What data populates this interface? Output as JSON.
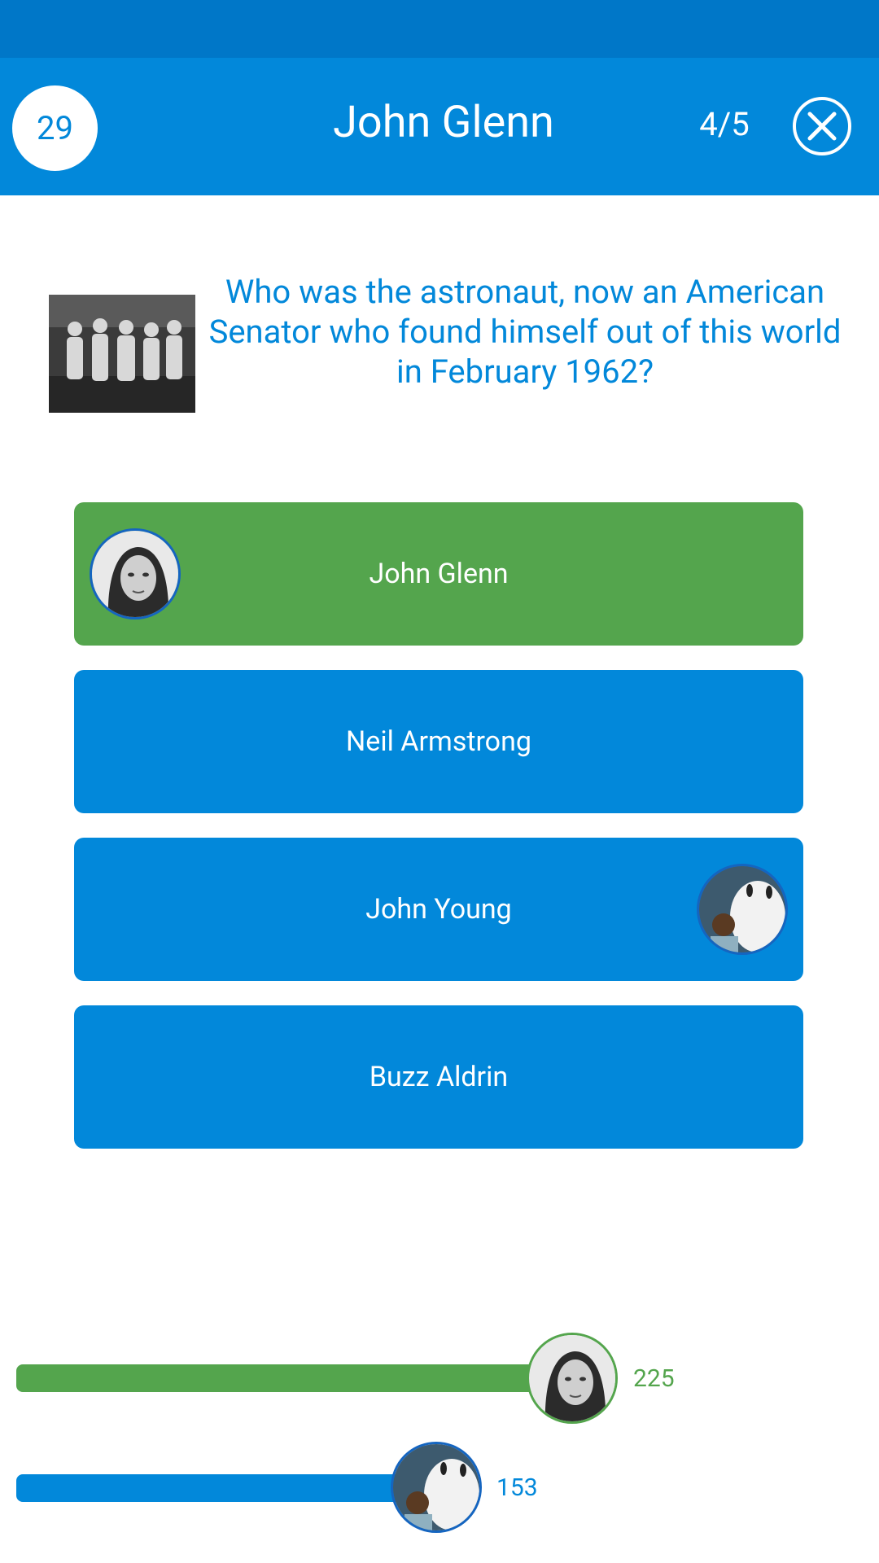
{
  "header": {
    "timer": "29",
    "title": "John Glenn",
    "progress": "4/5",
    "close_icon": "close-circle-icon"
  },
  "question": {
    "image": "astronauts-photo",
    "text": "Who was the astronaut, now an American Senator who found himself out of this world in February 1962?"
  },
  "answers": [
    {
      "label": "John Glenn",
      "state": "correct",
      "color": "#54a54d"
    },
    {
      "label": "Neil Armstrong",
      "state": "default",
      "color": "#0288da"
    },
    {
      "label": "John Young",
      "state": "default",
      "color": "#0288da"
    },
    {
      "label": "Buzz Aldrin",
      "state": "default",
      "color": "#0288da"
    }
  ],
  "scores": {
    "player": "225",
    "opponent": "153"
  },
  "colors": {
    "primary": "#0288da",
    "status_bar": "#0077c8",
    "correct": "#54a54d"
  }
}
